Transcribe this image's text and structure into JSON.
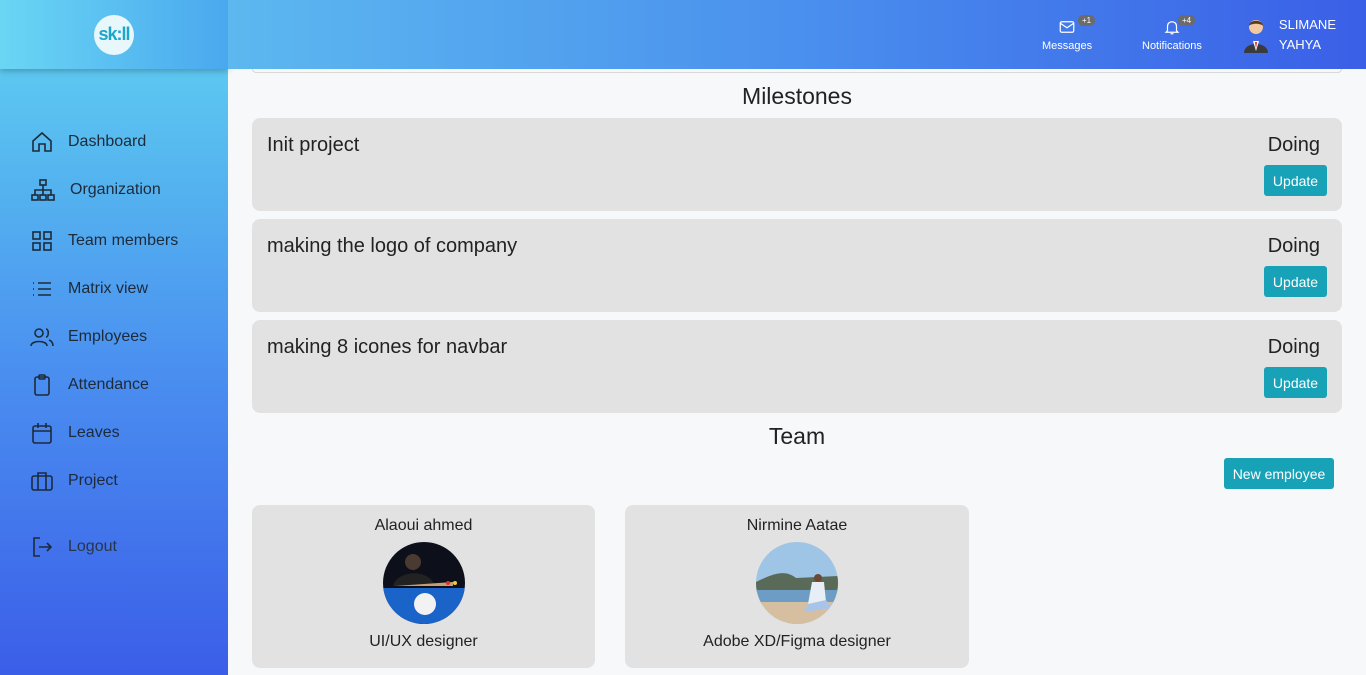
{
  "app": {
    "logo_text": "sk:ll"
  },
  "sidebar": {
    "items": [
      {
        "label": "Dashboard",
        "icon": "home-icon"
      },
      {
        "label": "Organization",
        "icon": "org-chart-icon"
      },
      {
        "label": "Team members",
        "icon": "grid-icon"
      },
      {
        "label": "Matrix view",
        "icon": "list-icon"
      },
      {
        "label": "Employees",
        "icon": "users-icon"
      },
      {
        "label": "Attendance",
        "icon": "clipboard-icon"
      },
      {
        "label": "Leaves",
        "icon": "calendar-icon"
      },
      {
        "label": "Project",
        "icon": "briefcase-icon"
      },
      {
        "label": "Logout",
        "icon": "logout-icon"
      }
    ]
  },
  "header": {
    "messages": {
      "label": "Messages",
      "badge": "+1",
      "icon": "envelope-icon"
    },
    "notifications": {
      "label": "Notifications",
      "badge": "+4",
      "icon": "bell-icon"
    },
    "user": {
      "first": "SLIMANE",
      "last": "YAHYA",
      "icon": "user-avatar"
    }
  },
  "milestones": {
    "title": "Milestones",
    "items": [
      {
        "title": "Init project",
        "status": "Doing",
        "button": "Update"
      },
      {
        "title": "making the logo of company",
        "status": "Doing",
        "button": "Update"
      },
      {
        "title": "making 8 icones for navbar",
        "status": "Doing",
        "button": "Update"
      }
    ]
  },
  "team": {
    "title": "Team",
    "new_button": "New employee",
    "members": [
      {
        "name": "Alaoui ahmed",
        "role": "UI/UX designer"
      },
      {
        "name": "Nirmine Aatae",
        "role": "Adobe XD/Figma designer"
      }
    ]
  },
  "colors": {
    "accent": "#17a2b8",
    "card": "#e2e2e2"
  }
}
